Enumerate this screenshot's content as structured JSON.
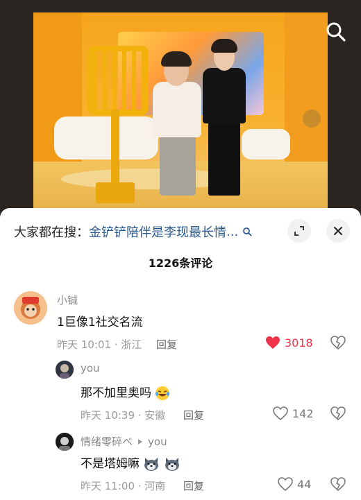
{
  "hot_search": {
    "prefix": "大家都在搜：",
    "query": "金铲铲陪伴是李现最长情",
    "ellipsis": "..."
  },
  "comments_header": {
    "count_label": "1226条评论"
  },
  "comments": [
    {
      "username": "小铖",
      "text": "1巨像1社交名流",
      "meta": "昨天 10:01 · 浙江",
      "reply_label": "回复",
      "likes": "3018",
      "liked": true
    },
    {
      "username": "you",
      "text": "那不加里奥吗",
      "meta": "昨天 10:39 · 安徽",
      "reply_label": "回复",
      "likes": "142",
      "liked": false
    },
    {
      "username": "情绪零碎ベ",
      "reply_to": "you",
      "text": "不是塔姆嘛",
      "meta": "昨天 11:00 · 河南",
      "reply_label": "回复",
      "likes": "44",
      "liked": false
    }
  ],
  "colors": {
    "like_active": "#f0354b",
    "link": "#2c5a8f"
  }
}
